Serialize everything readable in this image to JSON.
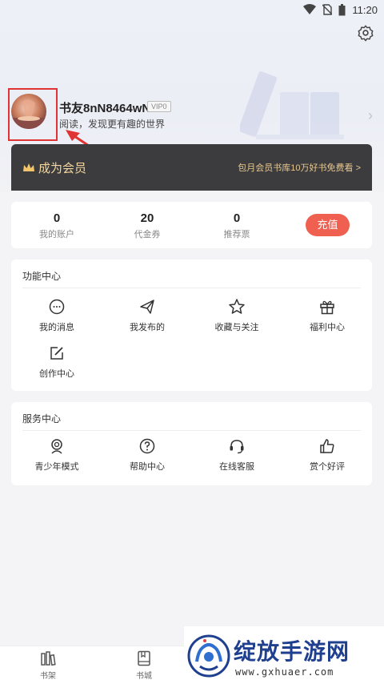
{
  "status_bar": {
    "time": "11:20"
  },
  "profile": {
    "username": "书友8nN8464wN",
    "vip_level": "VIP0",
    "motto": "阅读，发现更有趣的世界"
  },
  "vip_banner": {
    "title": "成为会员",
    "promo": "包月会员书库10万好书免费看 >",
    "accent_color": "#f4d7a0"
  },
  "stats": [
    {
      "value": "0",
      "label": "我的账户"
    },
    {
      "value": "20",
      "label": "代金券"
    },
    {
      "value": "0",
      "label": "推荐票"
    }
  ],
  "recharge_label": "充值",
  "function_center": {
    "title": "功能中心",
    "items": [
      {
        "label": "我的消息",
        "icon": "message-icon"
      },
      {
        "label": "我发布的",
        "icon": "send-icon"
      },
      {
        "label": "收藏与关注",
        "icon": "star-icon"
      },
      {
        "label": "福利中心",
        "icon": "gift-icon"
      },
      {
        "label": "创作中心",
        "icon": "edit-icon"
      }
    ]
  },
  "service_center": {
    "title": "服务中心",
    "items": [
      {
        "label": "青少年模式",
        "icon": "youth-icon"
      },
      {
        "label": "帮助中心",
        "icon": "help-icon"
      },
      {
        "label": "在线客服",
        "icon": "headset-icon"
      },
      {
        "label": "赏个好评",
        "icon": "thumbs-up-icon"
      }
    ]
  },
  "bottom_nav": [
    {
      "label": "书架",
      "icon": "bookshelf-icon"
    },
    {
      "label": "书城",
      "icon": "bookstore-icon"
    }
  ],
  "watermark": {
    "text": "绽放手游网",
    "url": "www.gxhuaer.com"
  },
  "colors": {
    "accent": "#f06050",
    "banner_bg": "#3c3c3e",
    "annotation": "#e03333"
  }
}
